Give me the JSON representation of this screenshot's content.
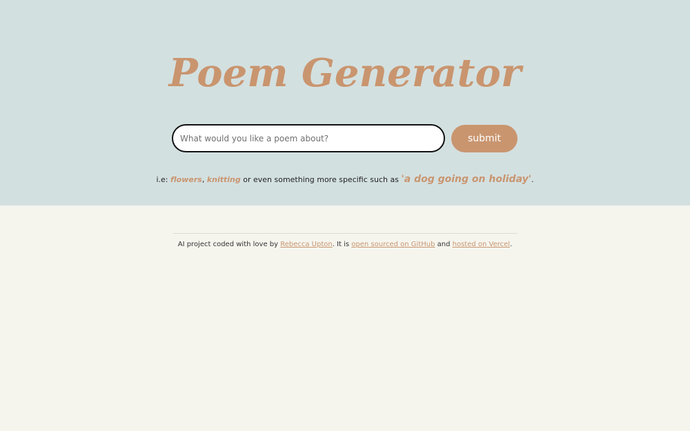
{
  "header": {
    "title": "Poem Generator"
  },
  "search": {
    "placeholder": "What would you like a poem about?",
    "value": "",
    "submit_label": "submit"
  },
  "hint": {
    "prefix": "i.e: ",
    "example1": "flowers",
    "sep": ", ",
    "example2": "knitting",
    "middle": " or even something more specific such as ",
    "example3": "'a dog going on holiday'",
    "suffix": "."
  },
  "footer": {
    "text1": "AI project coded with love by ",
    "author_link": "Rebecca Upton",
    "text2": ". It is ",
    "github_link": "open sourced on GitHub",
    "text3": " and ",
    "vercel_link": "hosted on Vercel",
    "text4": "."
  },
  "colors": {
    "hero_bg": "#d3e0e0",
    "page_bg": "#f5f5ee",
    "accent": "#c9956f"
  }
}
